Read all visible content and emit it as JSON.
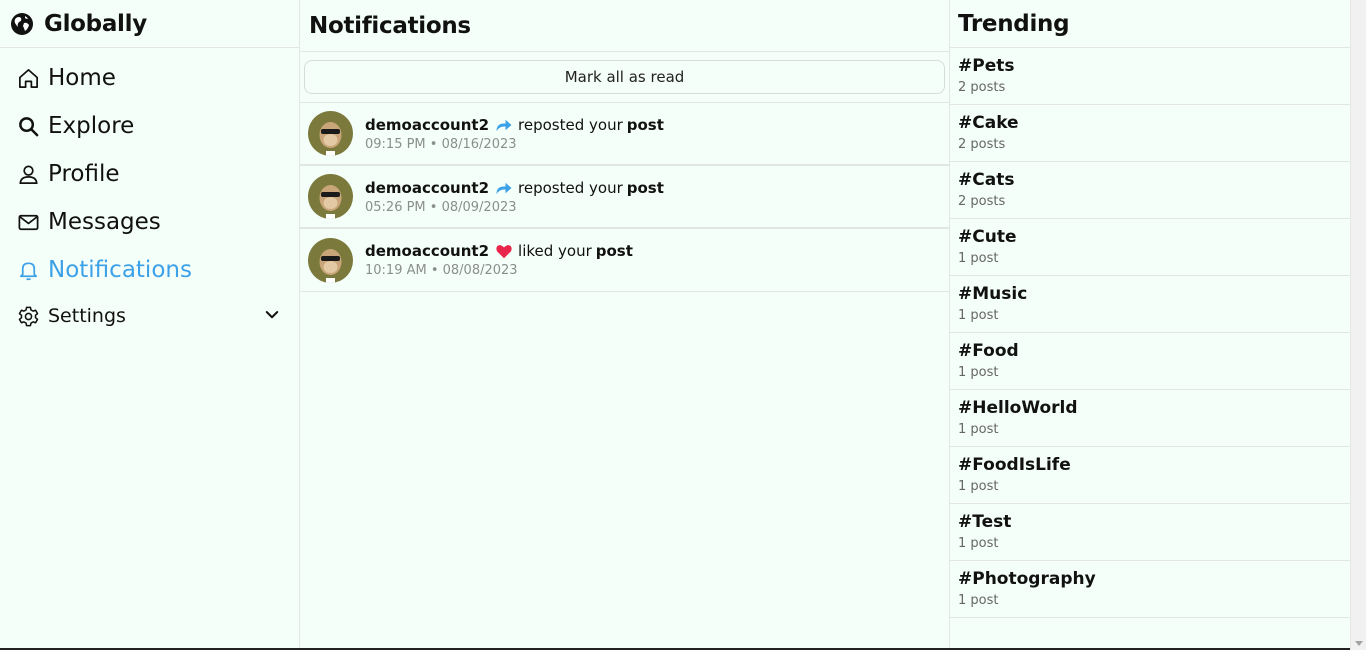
{
  "brand": {
    "name": "Globally",
    "icon": "globe-icon"
  },
  "nav": [
    {
      "label": "Home",
      "icon": "home-icon",
      "active": false
    },
    {
      "label": "Explore",
      "icon": "search-icon",
      "active": false
    },
    {
      "label": "Profile",
      "icon": "user-icon",
      "active": false
    },
    {
      "label": "Messages",
      "icon": "mail-icon",
      "active": false
    },
    {
      "label": "Notifications",
      "icon": "bell-icon",
      "active": true
    },
    {
      "label": "Settings",
      "icon": "gear-icon",
      "active": false
    }
  ],
  "main": {
    "title": "Notifications",
    "mark_all_label": "Mark all as read",
    "notifications": [
      {
        "user": "demoaccount2",
        "action_icon": "repost-icon",
        "action": "reposted your",
        "target": "post",
        "time": "09:15 PM • 08/16/2023"
      },
      {
        "user": "demoaccount2",
        "action_icon": "repost-icon",
        "action": "reposted your",
        "target": "post",
        "time": "05:26 PM • 08/09/2023"
      },
      {
        "user": "demoaccount2",
        "action_icon": "heart-icon",
        "action": "liked your",
        "target": "post",
        "time": "10:19 AM • 08/08/2023"
      }
    ]
  },
  "trending": {
    "title": "Trending",
    "items": [
      {
        "tag": "#Pets",
        "count": "2 posts"
      },
      {
        "tag": "#Cake",
        "count": "2 posts"
      },
      {
        "tag": "#Cats",
        "count": "2 posts"
      },
      {
        "tag": "#Cute",
        "count": "1 post"
      },
      {
        "tag": "#Music",
        "count": "1 post"
      },
      {
        "tag": "#Food",
        "count": "1 post"
      },
      {
        "tag": "#HelloWorld",
        "count": "1 post"
      },
      {
        "tag": "#FoodIsLife",
        "count": "1 post"
      },
      {
        "tag": "#Test",
        "count": "1 post"
      },
      {
        "tag": "#Photography",
        "count": "1 post"
      }
    ]
  },
  "colors": {
    "accent": "#3da1e8",
    "background": "#f5fff9",
    "heart": "#e8264c",
    "muted": "#8a8f8c"
  }
}
